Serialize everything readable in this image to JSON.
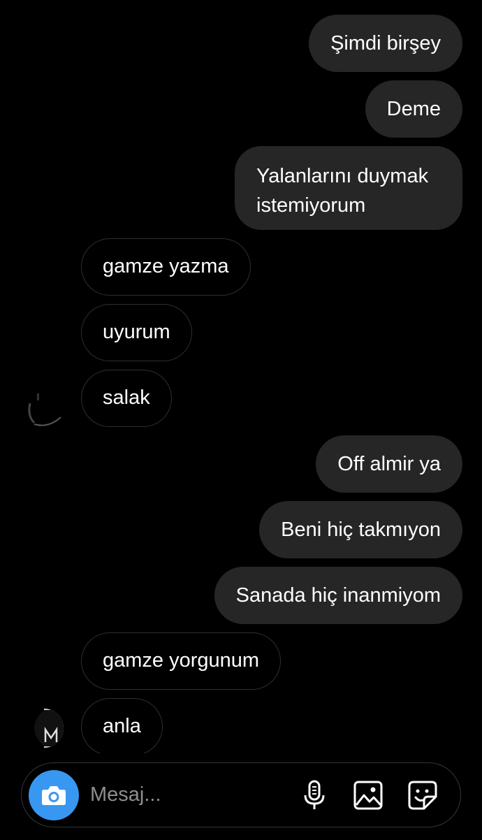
{
  "thread": {
    "messages": [
      {
        "from": "me",
        "text": "Şimdi birşey"
      },
      {
        "from": "me",
        "text": "Deme"
      },
      {
        "from": "me",
        "text": "Yalanlarını duymak istemiyorum"
      },
      {
        "from": "them",
        "text": "gamze yazma"
      },
      {
        "from": "them",
        "text": "uyurum"
      },
      {
        "from": "them",
        "text": "salak"
      },
      {
        "from": "me",
        "text": "Off almir ya"
      },
      {
        "from": "me",
        "text": "Beni hiç takmıyon"
      },
      {
        "from": "me",
        "text": "Sanada hiç inanmiyom"
      },
      {
        "from": "them",
        "text": "gamze yorgunum"
      },
      {
        "from": "them",
        "text": "anla"
      }
    ]
  },
  "composer": {
    "placeholder": "Mesaj...",
    "value": "",
    "icons": [
      "camera-icon",
      "microphone-icon",
      "gallery-icon",
      "sticker-icon"
    ],
    "accent_color": "#3897f0"
  },
  "colors": {
    "background": "#000000",
    "sent_bubble": "#262626",
    "received_border": "#2f2f2f",
    "placeholder": "#8e8e8e"
  }
}
